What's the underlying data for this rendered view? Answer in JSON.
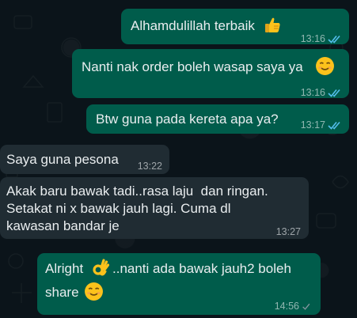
{
  "messages": [
    {
      "direction": "outgoing",
      "text": "Alhamdulillah terbaik",
      "emoji": "thumbs-up",
      "time": "13:16",
      "status": "read"
    },
    {
      "direction": "outgoing",
      "text": "Nanti nak order boleh wasap saya ya",
      "emoji": "smile",
      "time": "13:16",
      "status": "read"
    },
    {
      "direction": "outgoing",
      "text": "Btw guna pada kereta apa ya?",
      "time": "13:17",
      "status": "read"
    },
    {
      "direction": "incoming",
      "text": "Saya guna pesona",
      "time": "13:22"
    },
    {
      "direction": "incoming",
      "lines": [
        "Akak baru bawak tadi..rasa laju  dan ringan.",
        "Setakat ni x bawak jauh lagi. Cuma dl",
        "kawasan bandar je"
      ],
      "time": "13:27"
    },
    {
      "direction": "outgoing",
      "lines": [
        "Alright",
        "..nanti ada bawak jauh2 boleh",
        "share"
      ],
      "emoji": "ok-hand",
      "emoji2": "smile",
      "time": "14:56",
      "status": "sent"
    }
  ],
  "colors": {
    "outgoing_bubble": "#005c4b",
    "incoming_bubble": "#202c33",
    "read_tick": "#53bdeb",
    "sent_tick": "#8696a0",
    "background": "#0b141a"
  }
}
